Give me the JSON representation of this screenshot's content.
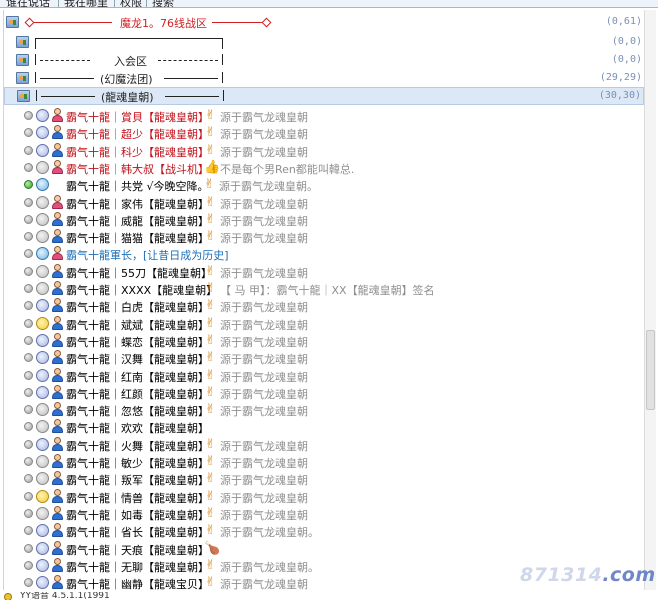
{
  "tabs": [
    {
      "label": "谁在说话"
    },
    {
      "label": "我在哪里"
    },
    {
      "label": "权限"
    },
    {
      "label": "搜索"
    }
  ],
  "groups": [
    {
      "title": "魔龙1。76线战区",
      "count": "(0,61)",
      "style": "red-diamond"
    },
    {
      "title": "",
      "count": "(0,0)",
      "style": "bracket-top"
    },
    {
      "title": "入会区",
      "count": "(0,0)",
      "style": "dash-center"
    },
    {
      "title": "(幻魔法团)",
      "count": "(29,29)",
      "style": "bar-center"
    },
    {
      "title": "(龍魂皇朝)",
      "count": "(30,30)",
      "style": "bar-center-selected"
    }
  ],
  "members": [
    {
      "status": "gray",
      "face": "moon",
      "avatar": "female",
      "name": "霸气十龍｜賞貝【龍魂皇朝】",
      "name_color": "red",
      "badge": "✌",
      "signature": "源于霸气龙魂皇朝"
    },
    {
      "status": "gray",
      "face": "moon",
      "avatar": "male",
      "name": "霸气十龍｜超少【龍魂皇朝】",
      "name_color": "red",
      "badge": "✌",
      "signature": "源于霸气龙魂皇朝"
    },
    {
      "status": "gray",
      "face": "moon",
      "avatar": "male",
      "name": "霸气十龍｜科少【龍魂皇朝】",
      "name_color": "red",
      "badge": "✌",
      "signature": "源于霸气龙魂皇朝"
    },
    {
      "status": "gray",
      "face": "sleep",
      "avatar": "female",
      "name": "霸气十龍｜韩大叔【战斗机】",
      "name_color": "red",
      "badge": "👍",
      "signature": "不是每个男Ren都能叫韓总."
    },
    {
      "status": "green",
      "face": "blue",
      "avatar": "none",
      "name": "霸气十龍｜共党 √今晚空降。",
      "name_color": "black",
      "badge": "✌",
      "signature": "源于霸气龙魂皇朝。"
    },
    {
      "status": "gray",
      "face": "sleep",
      "avatar": "female",
      "name": "霸气十龍｜家伟【龍魂皇朝】",
      "name_color": "black",
      "badge": "✌",
      "signature": "源于霸气龙魂皇朝"
    },
    {
      "status": "gray",
      "face": "sleep",
      "avatar": "male",
      "name": "霸气十龍｜威龍【龍魂皇朝】",
      "name_color": "black",
      "badge": "✌",
      "signature": "源于霸气龙魂皇朝"
    },
    {
      "status": "gray",
      "face": "sleep",
      "avatar": "male",
      "name": "霸气十龍｜猫猫【龍魂皇朝】",
      "name_color": "black",
      "badge": "✌",
      "signature": "源于霸气龙魂皇朝"
    },
    {
      "status": "gray",
      "face": "blue",
      "avatar": "female",
      "name": "霸气十龍軍长，[让昔日成为历史]",
      "name_color": "blue",
      "badge": "",
      "signature": ""
    },
    {
      "status": "gray",
      "face": "sleep",
      "avatar": "male",
      "name": "霸气十龍｜55刀【龍魂皇朝】",
      "name_color": "black",
      "badge": "✌",
      "signature": "源于霸气龙魂皇朝"
    },
    {
      "status": "gray",
      "face": "sleep",
      "avatar": "male",
      "name": "霸气十龍｜XXXX【龍魂皇朝】",
      "name_color": "black",
      "badge": "✌",
      "signature": "【 马 甲】：霸气十龍｜XX【龍魂皇朝】签名"
    },
    {
      "status": "gray",
      "face": "moon",
      "avatar": "male",
      "name": "霸气十龍｜白虎【龍魂皇朝】",
      "name_color": "black",
      "badge": "✌",
      "signature": "源于霸气龙魂皇朝"
    },
    {
      "status": "gray",
      "face": "star",
      "avatar": "male",
      "name": "霸气十龍｜斌斌【龍魂皇朝】",
      "name_color": "black",
      "badge": "✌",
      "signature": "源于霸气龙魂皇朝"
    },
    {
      "status": "gray",
      "face": "moon",
      "avatar": "male",
      "name": "霸气十龍｜蝶恋【龍魂皇朝】",
      "name_color": "black",
      "badge": "✌",
      "signature": "源于霸气龙魂皇朝"
    },
    {
      "status": "gray",
      "face": "moon",
      "avatar": "male",
      "name": "霸气十龍｜汉舞【龍魂皇朝】",
      "name_color": "black",
      "badge": "✌",
      "signature": "源于霸气龙魂皇朝"
    },
    {
      "status": "gray",
      "face": "moon",
      "avatar": "male",
      "name": "霸气十龍｜红南【龍魂皇朝】",
      "name_color": "black",
      "badge": "✌",
      "signature": "源于霸气龙魂皇朝"
    },
    {
      "status": "gray",
      "face": "moon",
      "avatar": "male",
      "name": "霸气十龍｜红颜【龍魂皇朝】",
      "name_color": "black",
      "badge": "✌",
      "signature": "源于霸气龙魂皇朝"
    },
    {
      "status": "gray",
      "face": "sleep",
      "avatar": "male",
      "name": "霸气十龍｜忽悠【龍魂皇朝】",
      "name_color": "black",
      "badge": "✌",
      "signature": "源于霸气龙魂皇朝"
    },
    {
      "status": "gray",
      "face": "sleep",
      "avatar": "male",
      "name": "霸气十龍｜欢欢【龍魂皇朝】",
      "name_color": "black",
      "badge": "",
      "signature": ""
    },
    {
      "status": "gray",
      "face": "moon",
      "avatar": "male",
      "name": "霸气十龍｜火舞【龍魂皇朝】",
      "name_color": "black",
      "badge": "✌",
      "signature": "源于霸气龙魂皇朝"
    },
    {
      "status": "gray",
      "face": "sleep",
      "avatar": "male",
      "name": "霸气十龍｜敏少【龍魂皇朝】",
      "name_color": "black",
      "badge": "✌",
      "signature": "源于霸气龙魂皇朝"
    },
    {
      "status": "gray",
      "face": "sleep",
      "avatar": "male",
      "name": "霸气十龍｜叛军【龍魂皇朝】",
      "name_color": "black",
      "badge": "✌",
      "signature": "源于霸气龙魂皇朝"
    },
    {
      "status": "gray",
      "face": "star",
      "avatar": "male",
      "name": "霸气十龍｜情兽【龍魂皇朝】",
      "name_color": "black",
      "badge": "✌",
      "signature": "源于霸气龙魂皇朝"
    },
    {
      "status": "gray",
      "face": "sleep",
      "avatar": "male",
      "name": "霸气十龍｜如毒【龍魂皇朝】",
      "name_color": "black",
      "badge": "✌",
      "signature": "源于霸气龙魂皇朝"
    },
    {
      "status": "gray",
      "face": "moon",
      "avatar": "male",
      "name": "霸气十龍｜省长【龍魂皇朝】",
      "name_color": "black",
      "badge": "✌",
      "signature": "源于霸气龙魂皇朝。"
    },
    {
      "status": "gray",
      "face": "moon",
      "avatar": "male",
      "name": "霸气十龍｜天痕【龍魂皇朝】",
      "name_color": "black",
      "badge": "🍗",
      "signature": ""
    },
    {
      "status": "gray",
      "face": "moon",
      "avatar": "male",
      "name": "霸气十龍｜无聊【龍魂皇朝】",
      "name_color": "black",
      "badge": "✌",
      "signature": "源于霸气龙魂皇朝。"
    },
    {
      "status": "gray",
      "face": "moon",
      "avatar": "male",
      "name": "霸气十龍｜幽静【龍魂宝贝】",
      "name_color": "black",
      "badge": "✌",
      "signature": "源于霸气龙魂皇朝"
    }
  ],
  "watermark": {
    "main": "871314",
    "suffix": ".com"
  },
  "status_bar": {
    "text": "YY语音 4.5.1.1(1991"
  },
  "colors": {
    "accent_red": "#d02020",
    "count_blue": "#7b8fb8",
    "signature_gray": "#8f8f8f",
    "selection": "#dde8f6"
  }
}
